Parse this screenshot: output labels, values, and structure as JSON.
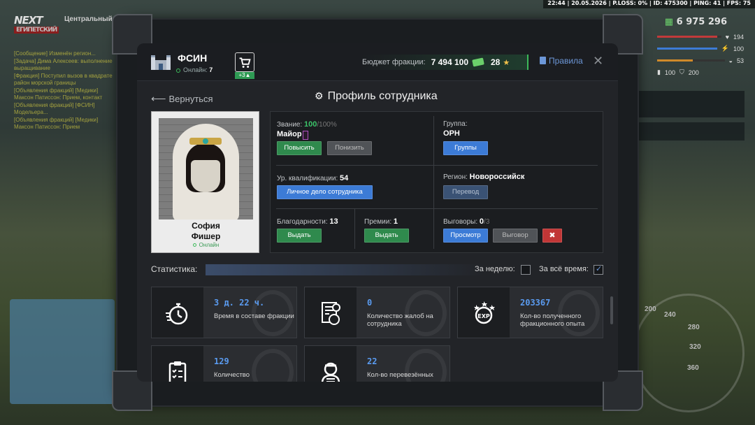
{
  "hud": {
    "top_status": "22:44 | 20.05.2026 | P.LOSS: 0% | ID: 475300 | PING: 41 | FPS: 75",
    "money": "6 975 296",
    "stats": [
      {
        "value": "194",
        "color": "#c23a3a",
        "level": 0.94
      },
      {
        "value": "100",
        "color": "#3c7bd6",
        "level": 1.0
      },
      {
        "value": "53",
        "color": "#d08a2a",
        "level": 0.53
      },
      {
        "value": "100",
        "value2": "200",
        "color": "#cccccc",
        "level": 1.0
      }
    ]
  },
  "logo": {
    "top": "NEXT",
    "bottom": "ЕГИПЕТСКИЙ"
  },
  "zone": "Центральный",
  "chat_lines": [
    "[Сообщение] Изменён регион...",
    "[Задача] Дима Алексеев: выполнение",
    "выращивание",
    "[Фракция] Поступил вызов в квадрате",
    "район морской границы",
    "[Объявления фракций] [Медики]",
    "Максон Патиссон: Прием, контакт",
    "[Объявления фракций] [ФСИН]",
    "Модельера...",
    "[Объявления фракций] [Медики]",
    "Максон Патиссон: Прием"
  ],
  "header": {
    "faction_name": "ФСИН",
    "online_label": "Онлайн:",
    "online_count": "7",
    "cart_badge": "+3",
    "budget_label": "Бюджет фракции:",
    "budget_value": "7 494 100",
    "tokens": "28",
    "rules_label": "Правила"
  },
  "nav": {
    "back_label": "Вернуться",
    "page_title": "Профиль сотрудника"
  },
  "profile": {
    "first_name": "София",
    "last_name": "Фишер",
    "status": "Онлайн"
  },
  "info": {
    "rank_label": "Звание:",
    "rank_progress": "100",
    "rank_progress_max": "/100%",
    "rank_name": "Майор",
    "promote_btn": "Повысить",
    "demote_btn": "Понизить",
    "group_label": "Группа:",
    "group_name": "ОРН",
    "groups_btn": "Группы",
    "qual_label": "Ур. квалификации:",
    "qual_value": "54",
    "personal_file_btn": "Личное дело сотрудника",
    "region_label": "Регион:",
    "region_value": "Новороссийск",
    "transfer_btn": "Перевод",
    "thanks_label": "Благодарности:",
    "thanks_value": "13",
    "thanks_btn": "Выдать",
    "bonus_label": "Премии:",
    "bonus_value": "1",
    "bonus_btn": "Выдать",
    "reprimand_label": "Выговоры:",
    "reprimand_value": "0",
    "reprimand_max": "/3",
    "view_btn": "Просмотр",
    "reprimand_btn": "Выговор"
  },
  "stats": {
    "label": "Статистика:",
    "week_label": "За неделю:",
    "all_time_label": "За всё время:",
    "cards": [
      {
        "value": "3 д. 22 ч.",
        "desc": "Время в составе фракции",
        "icon": "stopwatch-icon"
      },
      {
        "value": "0",
        "desc": "Количество жалоб на сотрудника",
        "icon": "complaint-icon"
      },
      {
        "value": "203367",
        "desc": "Кол-во полученного фракционного опыта",
        "icon": "exp-icon"
      },
      {
        "value": "129",
        "desc": "Количество",
        "icon": "clipboard-icon"
      },
      {
        "value": "22",
        "desc": "Кол-во перевезённых",
        "icon": "prisoner-icon"
      }
    ]
  },
  "speedo_ticks": [
    "200",
    "240",
    "280",
    "320",
    "360"
  ]
}
